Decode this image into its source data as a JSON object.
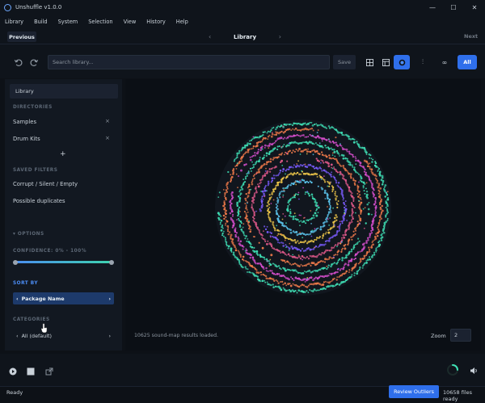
{
  "window": {
    "title": "Unshuffle v1.0.0",
    "minimize": "—",
    "maximize": "☐",
    "close": "✕"
  },
  "menu": [
    "Library",
    "Build",
    "System",
    "Selection",
    "View",
    "History",
    "Help"
  ],
  "nav": {
    "previous": "Previous",
    "center": "Library",
    "next": "Next",
    "left_chevron": "‹",
    "right_chevron": "›"
  },
  "toolbar": {
    "search_placeholder": "Search library...",
    "save_label": "Save",
    "sort_glyph": "⫶",
    "infinity_glyph": "∞",
    "all_label": "All"
  },
  "sidebar": {
    "library_label": "Library",
    "directories_header": "DIRECTORIES",
    "directories": [
      {
        "label": "Samples",
        "remove": "×"
      },
      {
        "label": "Drum Kits",
        "remove": "×"
      }
    ],
    "add_glyph": "+",
    "saved_filters_header": "SAVED FILTERS",
    "saved_filters": [
      "Corrupt / Silent / Empty",
      "Possible duplicates"
    ],
    "options_header": "▾ OPTIONS",
    "confidence_label": "CONFIDENCE: 0% - 100%",
    "confidence_min": 0,
    "confidence_max": 100,
    "sort_header": "SORT BY",
    "sort_value": "Package Name",
    "categories_header": "CATEGORIES",
    "categories_value": "All (default)",
    "chev_left": "‹",
    "chev_right": "›"
  },
  "main": {
    "results_text": "10625 sound-map results loaded.",
    "zoom_label": "Zoom",
    "zoom_value": "2",
    "ring_colors": [
      "#3fe0b5",
      "#f07a4a",
      "#d94fcf",
      "#3fe0b5",
      "#f07a4a",
      "#e35a8c",
      "#7b5cff",
      "#f0c84a",
      "#5cc7f0",
      "#3fe0b5"
    ]
  },
  "status": {
    "ready": "Ready",
    "review_label": "Review Outliers",
    "files_ready": "10658 files ready"
  },
  "colors": {
    "accent": "#2f6feb",
    "background": "#0d1117",
    "panel": "#121821"
  }
}
